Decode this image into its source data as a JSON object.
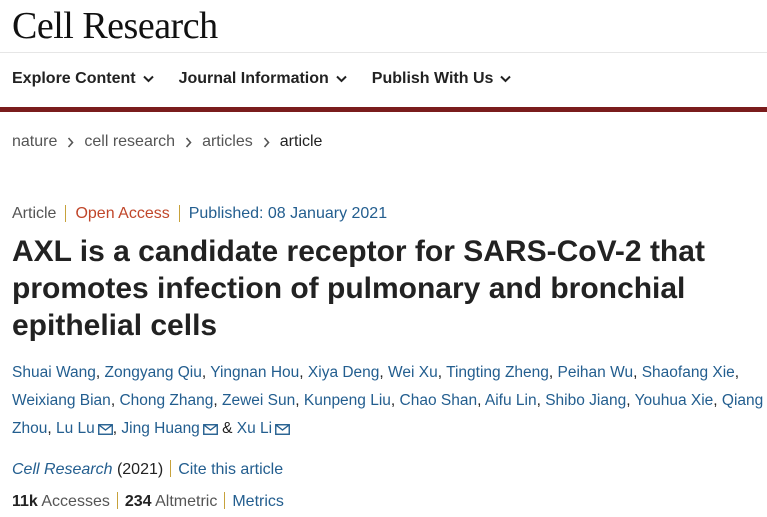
{
  "site": {
    "logo": "Cell Research"
  },
  "nav": {
    "items": [
      {
        "label": "Explore Content"
      },
      {
        "label": "Journal Information"
      },
      {
        "label": "Publish With Us"
      }
    ]
  },
  "breadcrumb": {
    "items": [
      "nature",
      "cell research",
      "articles",
      "article"
    ]
  },
  "article": {
    "type": "Article",
    "access": "Open Access",
    "published": "Published: 08 January 2021",
    "title": "AXL is a candidate receptor for SARS-CoV-2 that promotes infection of pulmonary and bronchial epithelial cells",
    "authors": [
      "Shuai Wang",
      "Zongyang Qiu",
      "Yingnan Hou",
      "Xiya Deng",
      "Wei Xu",
      "Tingting Zheng",
      "Peihan Wu",
      "Shaofang Xie",
      "Weixiang Bian",
      "Chong Zhang",
      "Zewei Sun",
      "Kunpeng Liu",
      "Chao Shan",
      "Aifu Lin",
      "Shibo Jiang",
      "Youhua Xie",
      "Qiang Zhou",
      "Lu Lu",
      "Jing Huang",
      "Xu Li"
    ],
    "author_and": "&",
    "journal": "Cell Research",
    "year": "(2021)",
    "cite_label": "Cite this article",
    "accesses_value": "11k",
    "accesses_label": "Accesses",
    "altmetric_value": "234",
    "altmetric_label": "Altmetric",
    "metrics_label": "Metrics"
  },
  "colors": {
    "link": "#235e8f",
    "open_access": "#c0462a",
    "nav_bar": "#7a1c1c",
    "separator": "#c7a23b"
  },
  "icons": {
    "chevron": "chevron-down-icon",
    "crumb_sep": "chevron-right-icon",
    "mail": "mail-icon"
  }
}
